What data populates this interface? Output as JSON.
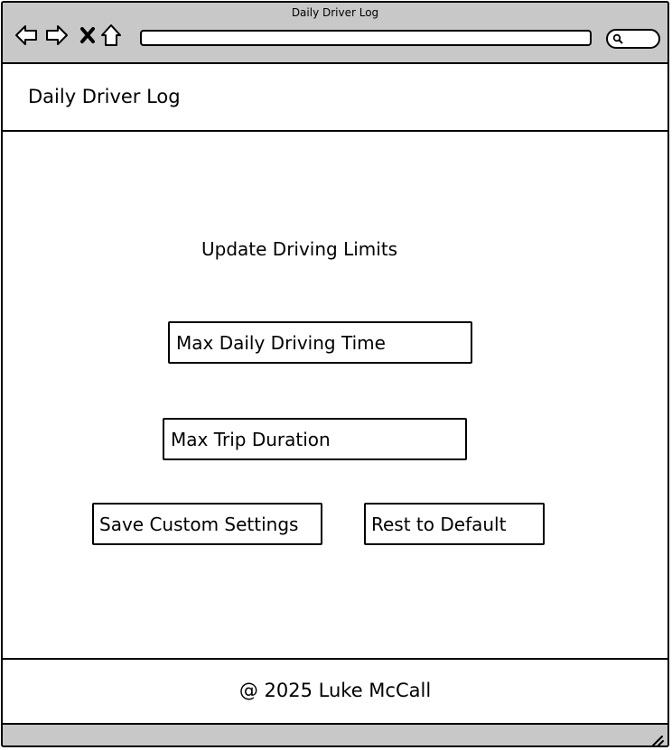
{
  "browser": {
    "tab_title": "Daily Driver Log",
    "address": "",
    "icons": [
      "back-arrow-icon",
      "forward-arrow-icon",
      "close-icon",
      "home-icon",
      "search-icon"
    ]
  },
  "header": {
    "title": "Daily Driver Log"
  },
  "main": {
    "heading": "Update Driving Limits",
    "max_daily_placeholder": "Max Daily Driving Time",
    "max_trip_placeholder": "Max Trip Duration",
    "save_label": "Save Custom Settings",
    "reset_label": "Rest to Default"
  },
  "footer": {
    "text": "@ 2025 Luke McCall"
  },
  "colors": {
    "chrome": "#c8c8c8",
    "border": "#000000",
    "background": "#ffffff"
  }
}
